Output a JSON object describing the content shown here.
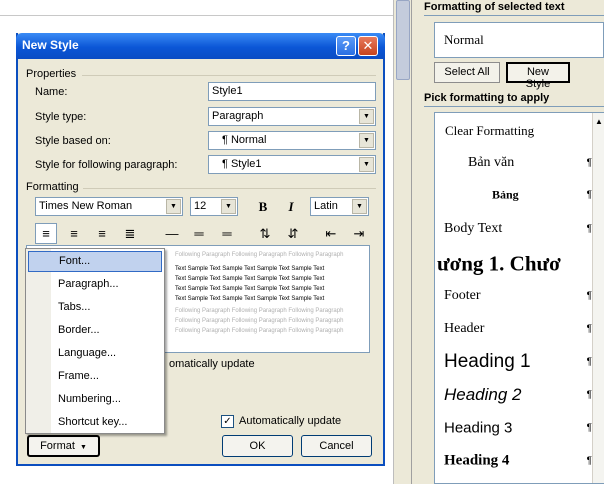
{
  "task_pane": {
    "formatting_heading": "Formatting of selected text",
    "current_style": "Normal",
    "select_all_label": "Select All",
    "new_style_label": "New Style",
    "pick_heading": "Pick formatting to apply",
    "styles": [
      {
        "name": "Clear Formatting",
        "para": ""
      },
      {
        "name": "Bản văn",
        "para": "¶"
      },
      {
        "name": "Bảng",
        "para": "¶"
      },
      {
        "name": "Body Text",
        "para": "¶"
      },
      {
        "name": "ương 1.  Chươ",
        "para": ""
      },
      {
        "name": "Footer",
        "para": "¶"
      },
      {
        "name": "Header",
        "para": "¶"
      },
      {
        "name": "Heading 1",
        "para": "¶"
      },
      {
        "name": "Heading 2",
        "para": "¶"
      },
      {
        "name": "Heading 3",
        "para": "¶"
      },
      {
        "name": "Heading 4",
        "para": "¶"
      }
    ]
  },
  "dialog": {
    "title": "New Style",
    "help_glyph": "?",
    "close_glyph": "✕",
    "properties_label": "Properties",
    "name_label": "Name:",
    "name_value": "Style1",
    "style_type_label": "Style type:",
    "style_type_value": "Paragraph",
    "based_on_label": "Style based on:",
    "based_on_value": "¶ Normal",
    "following_label": "Style for following paragraph:",
    "following_value": "¶ Style1",
    "formatting_label": "Formatting",
    "font_value": "Times New Roman",
    "size_value": "12",
    "bold_glyph": "B",
    "italic_glyph": "I",
    "script_value": "Latin",
    "auto_update_partial": "omatically update",
    "auto_update_label": "Automatically update",
    "auto_update_checked": "✓",
    "format_button": "Format",
    "ok_button": "OK",
    "cancel_button": "Cancel",
    "preview_grey": "Following Paragraph Following Paragraph Following Paragraph",
    "preview_sample": "Text Sample Text Sample Text Sample Text Sample Text"
  },
  "format_menu": [
    "Font...",
    "Paragraph...",
    "Tabs...",
    "Border...",
    "Language...",
    "Frame...",
    "Numbering...",
    "Shortcut key..."
  ],
  "colors": {
    "titlebar": "#0b56d6",
    "menu_highlight": "#c1d2ee",
    "dialog_bg": "#ece9d8"
  }
}
